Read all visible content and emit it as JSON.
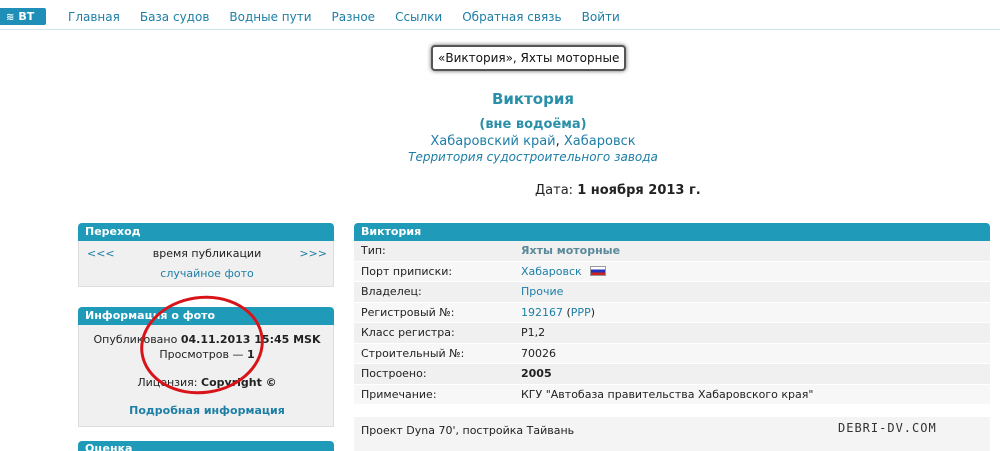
{
  "nav": {
    "logo": "BT",
    "items": [
      "Главная",
      "База судов",
      "Водные пути",
      "Разное",
      "Ссылки",
      "Обратная связь",
      "Войти"
    ]
  },
  "header": {
    "tag": "«Виктория», Яхты моторные",
    "title": "Виктория",
    "status": "(вне водоёма)",
    "region": "Хабаровский край",
    "city": "Хабаровск",
    "territory": "Территория судостроительного завода",
    "date_label": "Дата:",
    "date_value": "1 ноября 2013 г."
  },
  "transition": {
    "title": "Переход",
    "prev": "<<<",
    "middle": "время публикации",
    "next": ">>>",
    "random": "случайное фото"
  },
  "photo_info": {
    "title": "Информация о фото",
    "published_label": "Опубликовано",
    "published_value": "04.11.2013 15:45 MSK",
    "views_label": "Просмотров —",
    "views_value": "1",
    "license_label": "Лицензия:",
    "license_value": "Copyright ©",
    "details_link": "Подробная информация"
  },
  "rating": {
    "title": "Оценка"
  },
  "vessel": {
    "title": "Виктория",
    "rows": [
      {
        "label": "Тип:",
        "value": "Яхты моторные"
      },
      {
        "label": "Порт приписки:",
        "value": "Хабаровск"
      },
      {
        "label": "Владелец:",
        "value": "Прочие"
      },
      {
        "label": "Регистровый №:",
        "value": "192167",
        "extra": "РРР"
      },
      {
        "label": "Класс регистра:",
        "value": "Р1,2"
      },
      {
        "label": "Строительный №:",
        "value": "70026"
      },
      {
        "label": "Построено:",
        "value": "2005"
      },
      {
        "label": "Примечание:",
        "value": "КГУ \"Автобаза правительства Хабаровского края\""
      }
    ],
    "note": "Проект Dyna 70', постройка Тайвань"
  },
  "watermark": "DEBRI-DV.COM",
  "colors": {
    "accent": "#1f9ab8",
    "link": "#1d7ea6",
    "annotation": "#d8141a"
  }
}
